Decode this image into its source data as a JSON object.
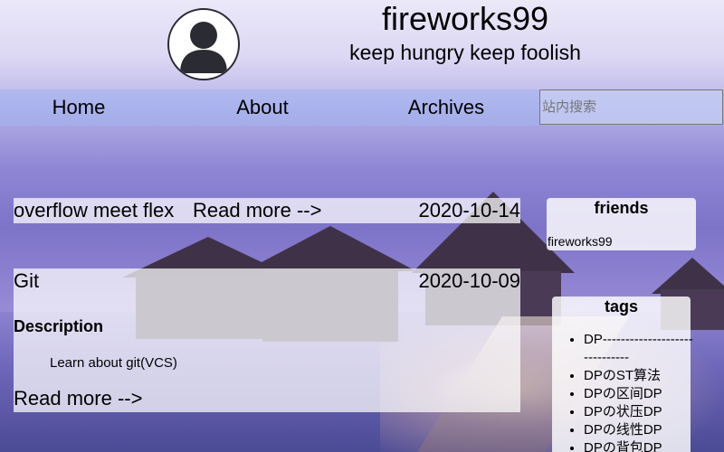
{
  "header": {
    "site_title": "fireworks99",
    "subtitle": "keep hungry keep foolish"
  },
  "nav": {
    "items": [
      {
        "label": "Home"
      },
      {
        "label": "About"
      },
      {
        "label": "Archives"
      }
    ],
    "search_placeholder": "站内搜索"
  },
  "posts": [
    {
      "title": "overflow meet flex",
      "read_more": "Read more -->",
      "date": "2020-10-14"
    },
    {
      "title": "Git",
      "date": "2020-10-09",
      "description_heading": "Description",
      "description": "Learn about git(VCS)",
      "read_more": "Read more -->"
    }
  ],
  "sidebar": {
    "friends": {
      "heading": "friends",
      "links": [
        {
          "label": "fireworks99"
        }
      ]
    },
    "tags": {
      "heading": "tags",
      "items": [
        {
          "label": "DP------------------------------"
        },
        {
          "label": "DPのST算法"
        },
        {
          "label": "DPの区间DP"
        },
        {
          "label": "DPの状压DP"
        },
        {
          "label": "DPの线性DP"
        },
        {
          "label": "DPの背包DP"
        }
      ]
    }
  },
  "colors": {
    "nav_background": "#a0b4f0",
    "sky_top": "#ebe8f8",
    "sky_bottom": "#7d73c8"
  }
}
